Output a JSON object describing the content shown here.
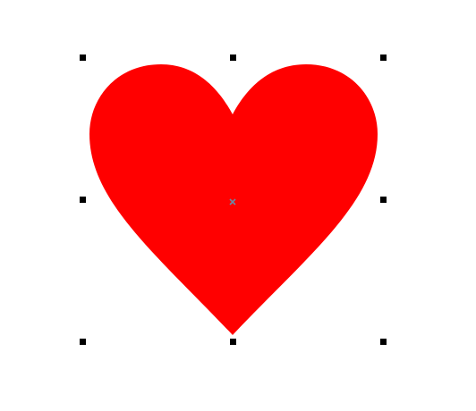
{
  "shape": {
    "kind": "heart",
    "fill_color": "#ff0000",
    "selected": true
  },
  "selection": {
    "handle_color": "#000000",
    "handles": [
      "top-left",
      "top-center",
      "top-right",
      "middle-left",
      "middle-right",
      "bottom-left",
      "bottom-center",
      "bottom-right"
    ],
    "center_marker": "rotation-center-icon",
    "center_marker_color": "#6b8aa6"
  }
}
